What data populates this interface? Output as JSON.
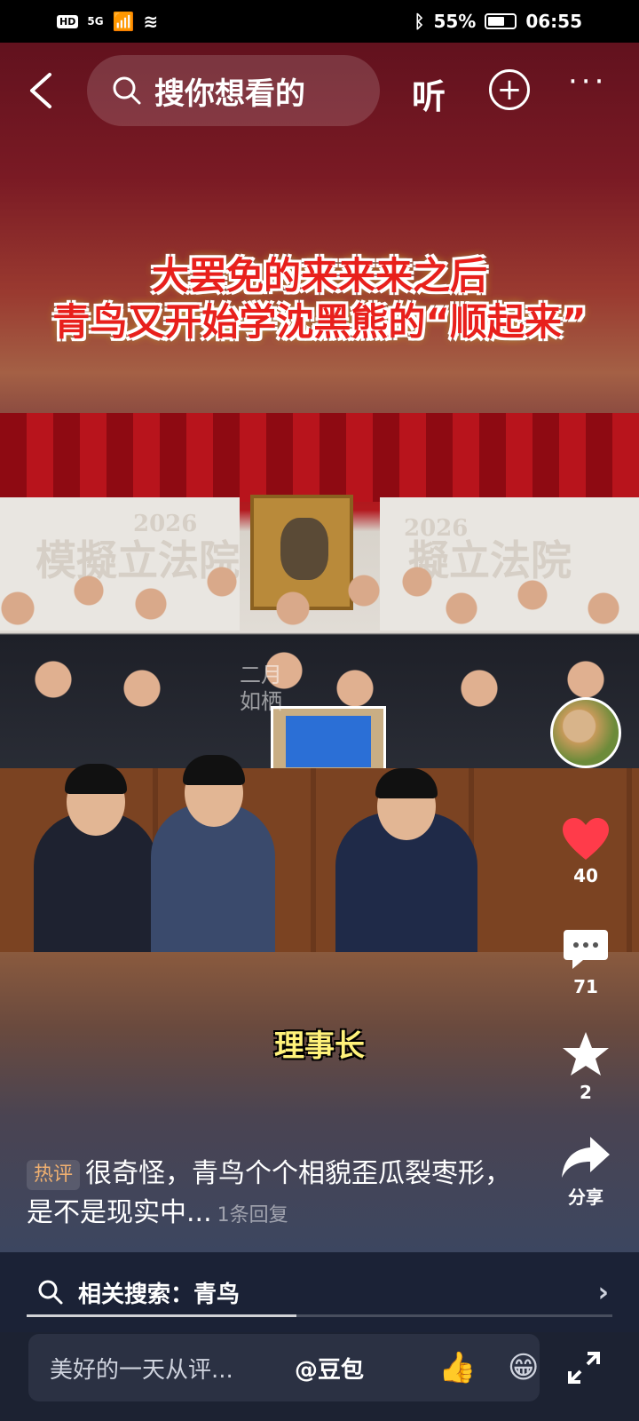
{
  "status_bar": {
    "network": "HD",
    "signal": "5G",
    "battery": "55%",
    "time": "06:55"
  },
  "top_nav": {
    "search_placeholder": "搜你想看的",
    "listen_label": "听"
  },
  "video": {
    "headline_line1": "大罢免的来来来之后",
    "headline_line2": "青鸟又开始学沈黑熊的“顺起来”",
    "banner_left": "模擬立法院",
    "banner_right": "擬立法院",
    "banner_year": "2026",
    "watermark": "二月\n如栖",
    "subtitle": "理事长"
  },
  "actions": {
    "likes": "40",
    "comments": "71",
    "favorites": "2",
    "share_label": "分享"
  },
  "hot_comment": {
    "tag": "热评",
    "text": "很奇怪，青鸟个个相貌歪瓜裂枣形，是不是现实中...",
    "replies": "1条回复"
  },
  "related_search": {
    "label": "相关搜索：青鸟"
  },
  "progress": 0.46,
  "bottom_bar": {
    "comment_placeholder": "美好的一天从评...",
    "mention": "@豆包",
    "emoji1": "👍",
    "emoji2": "😁"
  }
}
